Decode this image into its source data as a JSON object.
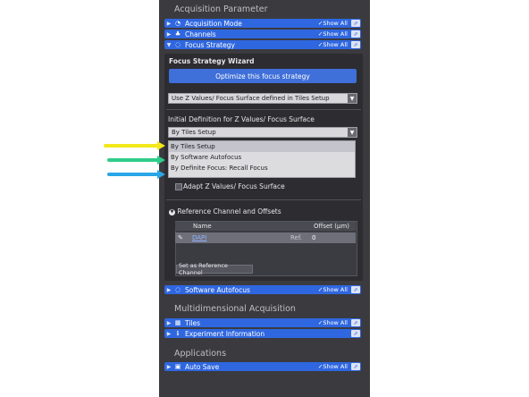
{
  "sections": {
    "acquisition_title": "Acquisition Parameter",
    "multidim_title": "Multidimensional Acquisition",
    "applications_title": "Applications"
  },
  "show_all_label": "Show All",
  "bars": {
    "acquisition_mode": "Acquisition Mode",
    "channels": "Channels",
    "focus_strategy": "Focus Strategy",
    "software_autofocus": "Software Autofocus",
    "tiles": "Tiles",
    "experiment_information": "Experiment Information",
    "auto_save": "Auto Save"
  },
  "focus": {
    "wizard_label": "Focus Strategy Wizard",
    "optimize_button": "Optimize this focus strategy",
    "strategy_value": "Use Z Values/ Focus Surface defined in Tiles Setup",
    "initial_def_label": "Initial Definition for Z Values/ Focus Surface",
    "initial_def_value": "By Tiles Setup",
    "options": [
      "By Tiles Setup",
      "By Software Autofocus",
      "By Definite Focus: Recall Focus"
    ],
    "adapt_label": "Adapt Z Values/ Focus Surface",
    "ref_channel_title": "Reference Channel and Offsets",
    "table_headers": {
      "name": "Name",
      "offset": "Offset (µm)"
    },
    "row": {
      "name": "DAPI",
      "ref": "Ref.",
      "offset": "0"
    },
    "set_ref_button": "Set as Reference Channel"
  },
  "annotation_colors": [
    "#f2e81a",
    "#2ecc8a",
    "#2aa6e8"
  ]
}
